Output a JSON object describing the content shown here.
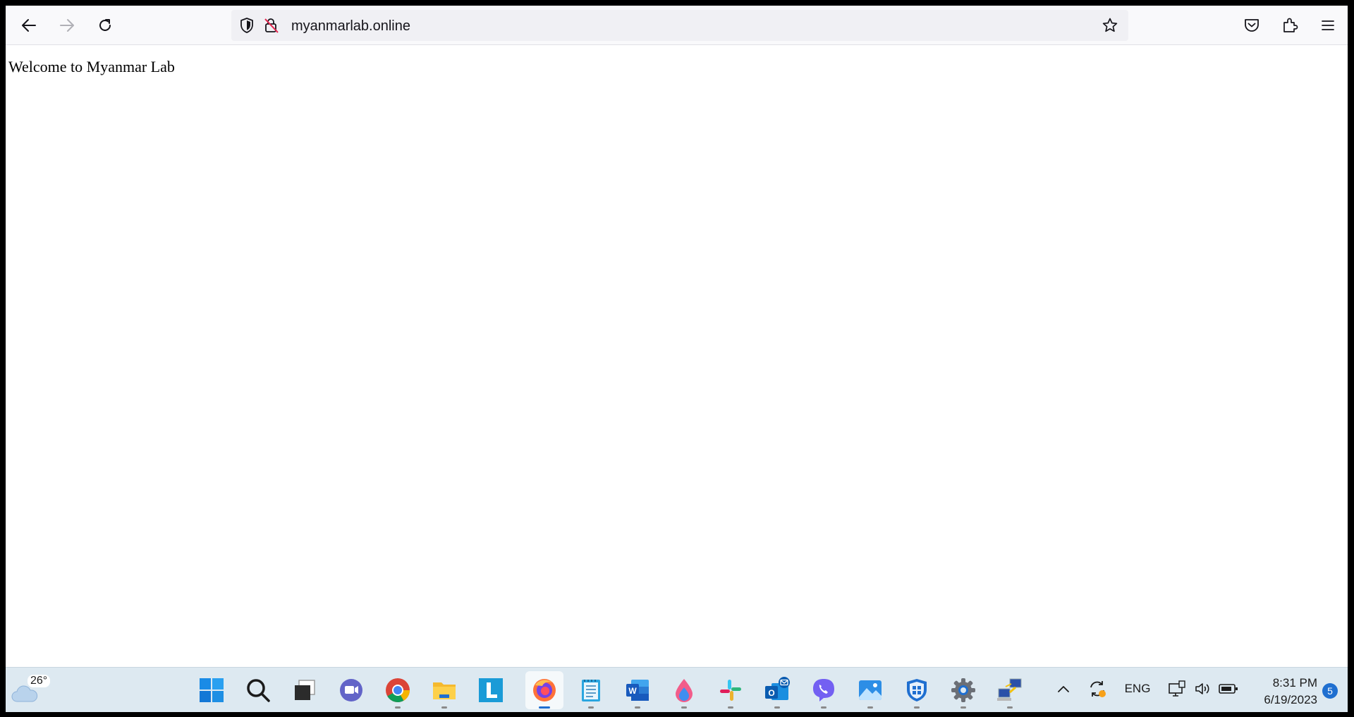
{
  "browser": {
    "url": "myanmarlab.online",
    "icons": [
      "back-icon",
      "forward-icon",
      "reload-icon",
      "tracking-protection-shield-icon",
      "insecure-connection-lock-icon",
      "bookmark-star-icon",
      "pocket-icon",
      "extensions-icon",
      "app-menu-icon"
    ]
  },
  "page": {
    "text": "Welcome to Myanmar Lab"
  },
  "taskbar": {
    "weather": {
      "temp": "26°"
    },
    "apps": [
      "start",
      "search",
      "task-view",
      "teams-chat",
      "chrome",
      "file-explorer",
      "l-app",
      "firefox",
      "notepad",
      "word",
      "paint",
      "slack",
      "outlook",
      "viber",
      "photos",
      "defender",
      "settings",
      "network-app"
    ],
    "active_app": "firefox",
    "tray": {
      "lang": "ENG",
      "time": "8:31 PM",
      "date": "6/19/2023",
      "notifications": "5"
    }
  }
}
